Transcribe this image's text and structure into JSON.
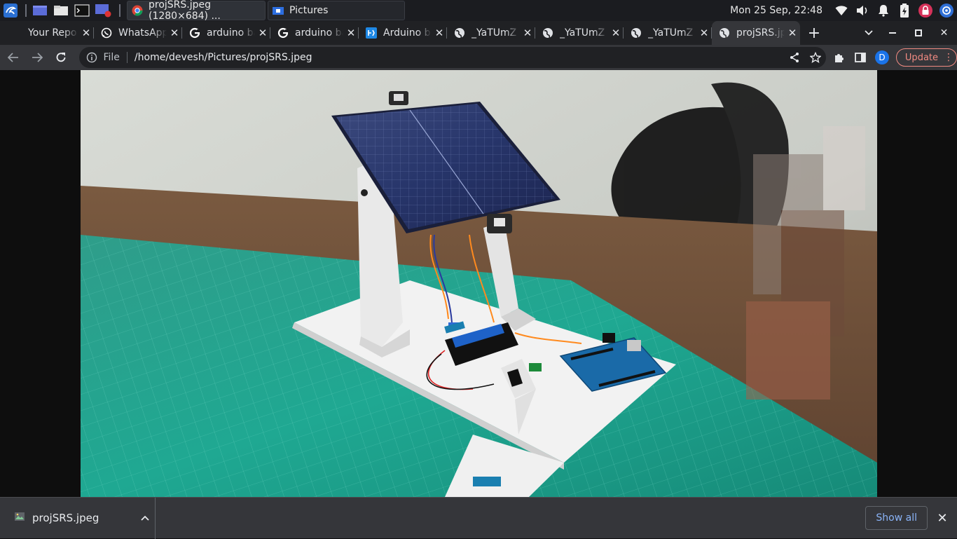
{
  "taskbar": {
    "apps": [
      {
        "name": "launcher",
        "icon": "kali-dragon-icon"
      },
      {
        "name": "workspace",
        "icon": "workspace-icon"
      },
      {
        "name": "file-manager",
        "icon": "folder-icon"
      },
      {
        "name": "terminal",
        "icon": "terminal-icon"
      },
      {
        "name": "screen-recorder",
        "icon": "screen-record-icon"
      }
    ],
    "windows": [
      {
        "label": "projSRS.jpeg (1280×684) ...",
        "icon": "chrome-icon",
        "active": true
      },
      {
        "label": "Pictures",
        "icon": "folder-icon",
        "active": false
      }
    ],
    "clock": "Mon 25 Sep, 22:48"
  },
  "browser": {
    "tabs": [
      {
        "title": "Your Repo",
        "icon": "github-icon"
      },
      {
        "title": "WhatsApp",
        "icon": "whatsapp-icon"
      },
      {
        "title": "arduino ba",
        "icon": "google-icon"
      },
      {
        "title": "arduino ba",
        "icon": "google-icon"
      },
      {
        "title": "Arduino b",
        "icon": "arduino-icon"
      },
      {
        "title": "_YaTUmZ",
        "icon": "globe-icon"
      },
      {
        "title": "_YaTUmZ",
        "icon": "globe-icon"
      },
      {
        "title": "_YaTUmZ",
        "icon": "globe-icon"
      },
      {
        "title": "projSRS.jp",
        "icon": "globe-icon",
        "active": true
      }
    ],
    "toolbar": {
      "file_label": "File",
      "url": "/home/devesh/Pictures/projSRS.jpeg",
      "profile_initial": "D",
      "update_label": "Update"
    }
  },
  "download": {
    "filename": "projSRS.jpeg",
    "show_all_label": "Show all"
  },
  "colors": {
    "accent": "#8ab4f8",
    "update": "#f28b82",
    "profile": "#1a73e8"
  }
}
